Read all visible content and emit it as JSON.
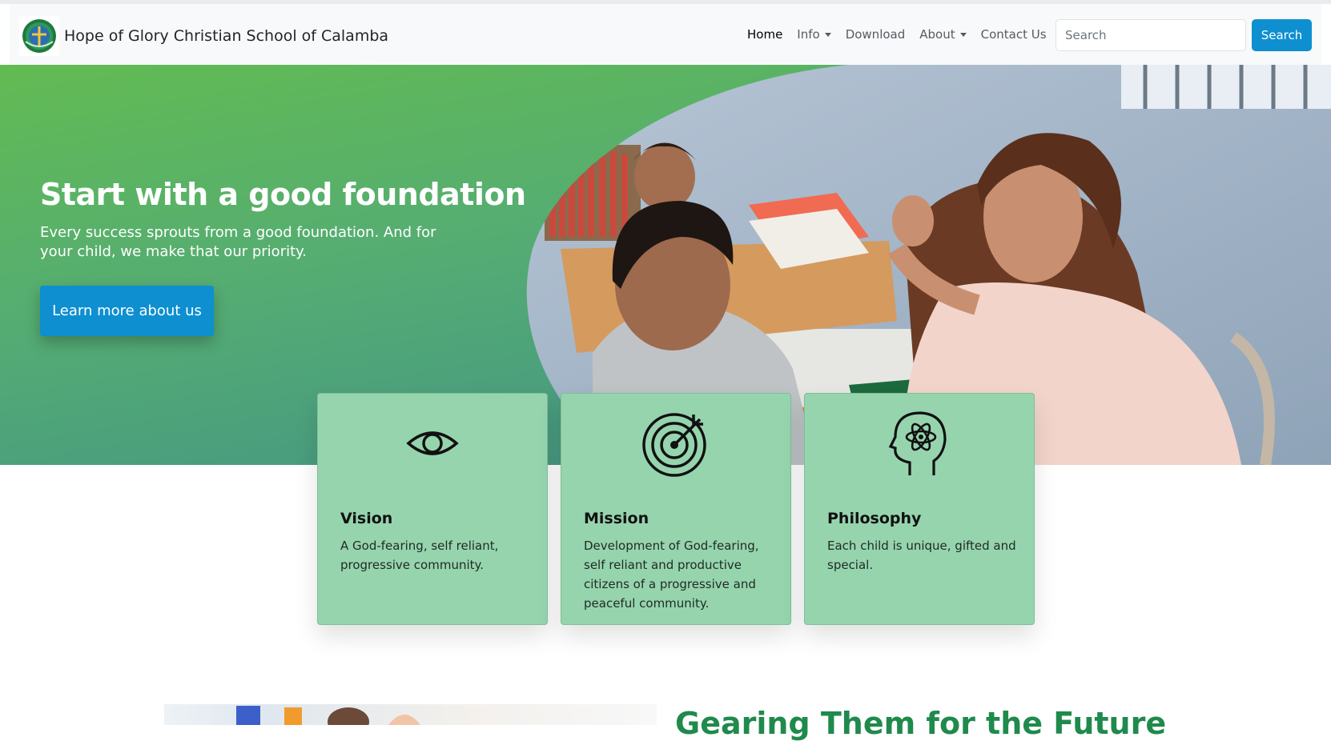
{
  "navbar": {
    "brand_name": "Hope of Glory Christian School of Calamba",
    "logo_icon": "school-crest-icon",
    "links": [
      {
        "label": "Home",
        "active": true,
        "dropdown": false
      },
      {
        "label": "Info",
        "active": false,
        "dropdown": true
      },
      {
        "label": "Download",
        "active": false,
        "dropdown": false
      },
      {
        "label": "About",
        "active": false,
        "dropdown": true
      },
      {
        "label": "Contact Us",
        "active": false,
        "dropdown": false
      }
    ],
    "search_placeholder": "Search",
    "search_button": "Search"
  },
  "hero": {
    "title": "Start with a good foundation",
    "subtitle": "Every success sprouts from a good foundation. And for your child, we make that our priority.",
    "button_label": "Learn more about us"
  },
  "cards": [
    {
      "icon": "eye-icon",
      "title": "Vision",
      "text": "A God-fearing, self reliant, progressive community."
    },
    {
      "icon": "target-icon",
      "title": "Mission",
      "text": "Development of God-fearing, self reliant and productive citizens of a progressive and peaceful community."
    },
    {
      "icon": "atom-head-icon",
      "title": "Philosophy",
      "text": "Each child is unique, gifted and special."
    }
  ],
  "section2": {
    "heading": "Gearing Them for the Future"
  },
  "colors": {
    "accent": "#0d8fd0",
    "card_bg": "#96d4ae",
    "hero_green": "#62bb52",
    "hero_teal": "#3f8e8a",
    "heading_green": "#1f8a4c"
  }
}
